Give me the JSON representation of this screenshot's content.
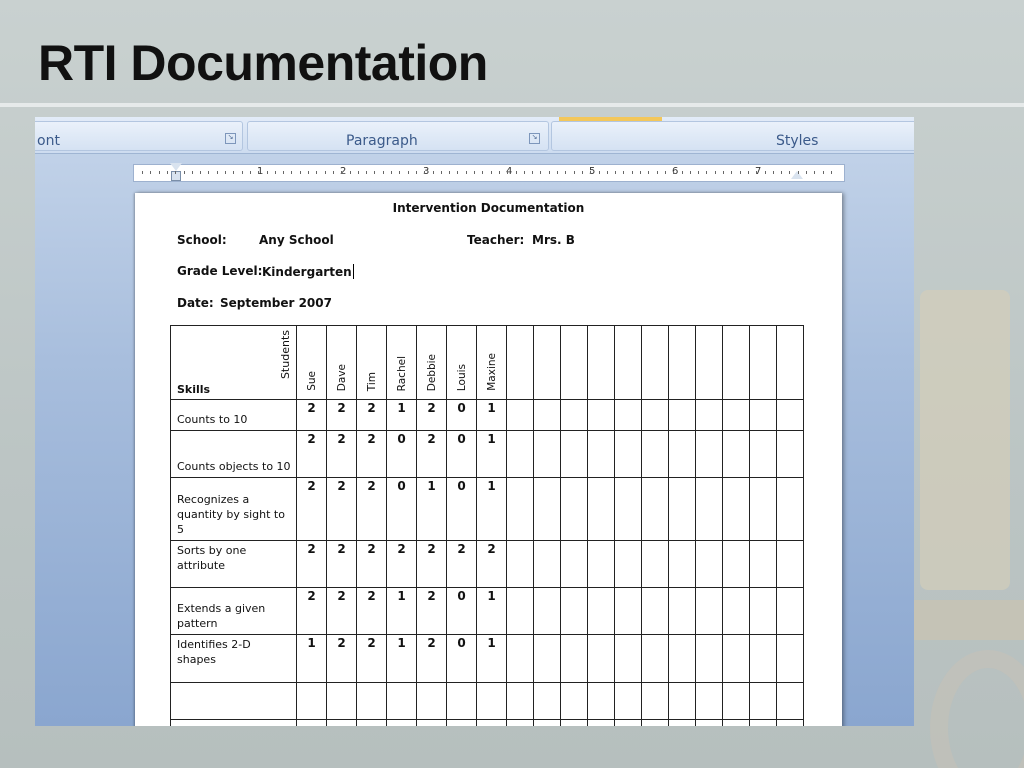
{
  "slide": {
    "title": "RTI Documentation"
  },
  "ribbon": {
    "groups": {
      "font_label": "ont",
      "paragraph_label": "Paragraph",
      "styles_label": "Styles"
    }
  },
  "ruler": {
    "numbers": [
      "1",
      "2",
      "3",
      "4",
      "5",
      "6",
      "7"
    ]
  },
  "document": {
    "title": "Intervention Documentation",
    "school_label": "School:",
    "school_value": "Any School",
    "teacher_label": "Teacher:",
    "teacher_value": "Mrs. B",
    "grade_label": "Grade Level:",
    "grade_value": "Kindergarten",
    "date_label": "Date:",
    "date_value": "September 2007",
    "table": {
      "corner_skills": "Skills",
      "corner_students": "Students",
      "students": [
        "Sue",
        "Dave",
        "Tim",
        "Rachel",
        "Debbie",
        "Louis",
        "Maxine"
      ],
      "rows": [
        {
          "skill": "Counts to 10",
          "scores": [
            "2",
            "2",
            "2",
            "1",
            "2",
            "0",
            "1"
          ]
        },
        {
          "skill": "Counts objects to 10",
          "scores": [
            "2",
            "2",
            "2",
            "0",
            "2",
            "0",
            "1"
          ]
        },
        {
          "skill": "Recognizes a quantity by sight to 5",
          "scores": [
            "2",
            "2",
            "2",
            "0",
            "1",
            "0",
            "1"
          ]
        },
        {
          "skill": "Sorts by one attribute",
          "scores": [
            "2",
            "2",
            "2",
            "2",
            "2",
            "2",
            "2"
          ]
        },
        {
          "skill": "Extends a given pattern",
          "scores": [
            "2",
            "2",
            "2",
            "1",
            "2",
            "0",
            "1"
          ]
        },
        {
          "skill": "Identifies 2-D shapes",
          "scores": [
            "1",
            "2",
            "2",
            "1",
            "2",
            "0",
            "1"
          ]
        }
      ]
    }
  }
}
